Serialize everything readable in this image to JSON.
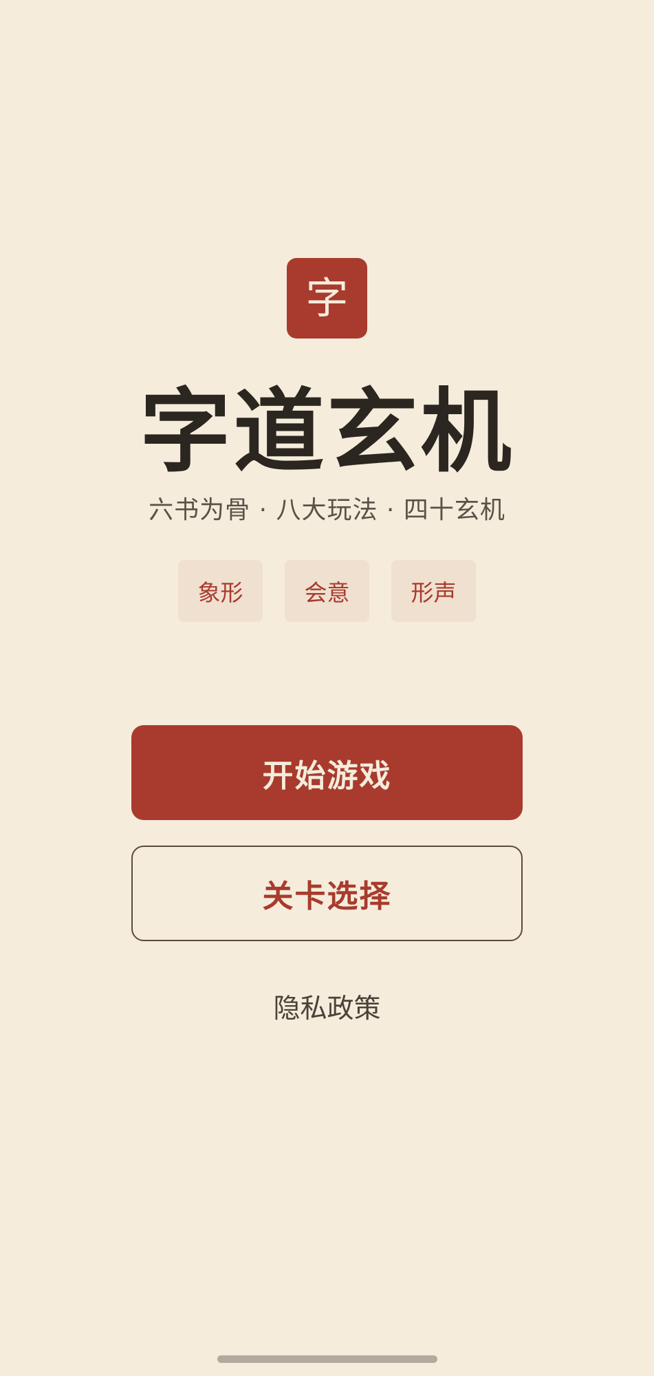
{
  "app": {
    "logo_char": "字",
    "title": "字道玄机",
    "subtitle": "六书为骨 · 八大玩法 · 四十玄机"
  },
  "tags": [
    {
      "label": "象形"
    },
    {
      "label": "会意"
    },
    {
      "label": "形声"
    }
  ],
  "buttons": {
    "start_label": "开始游戏",
    "levels_label": "关卡选择"
  },
  "footer": {
    "privacy_label": "隐私政策"
  },
  "colors": {
    "background": "#f5ecdc",
    "accent": "#a83b2d",
    "tag_background": "#f0e0d0",
    "title_text": "#2b2620"
  }
}
